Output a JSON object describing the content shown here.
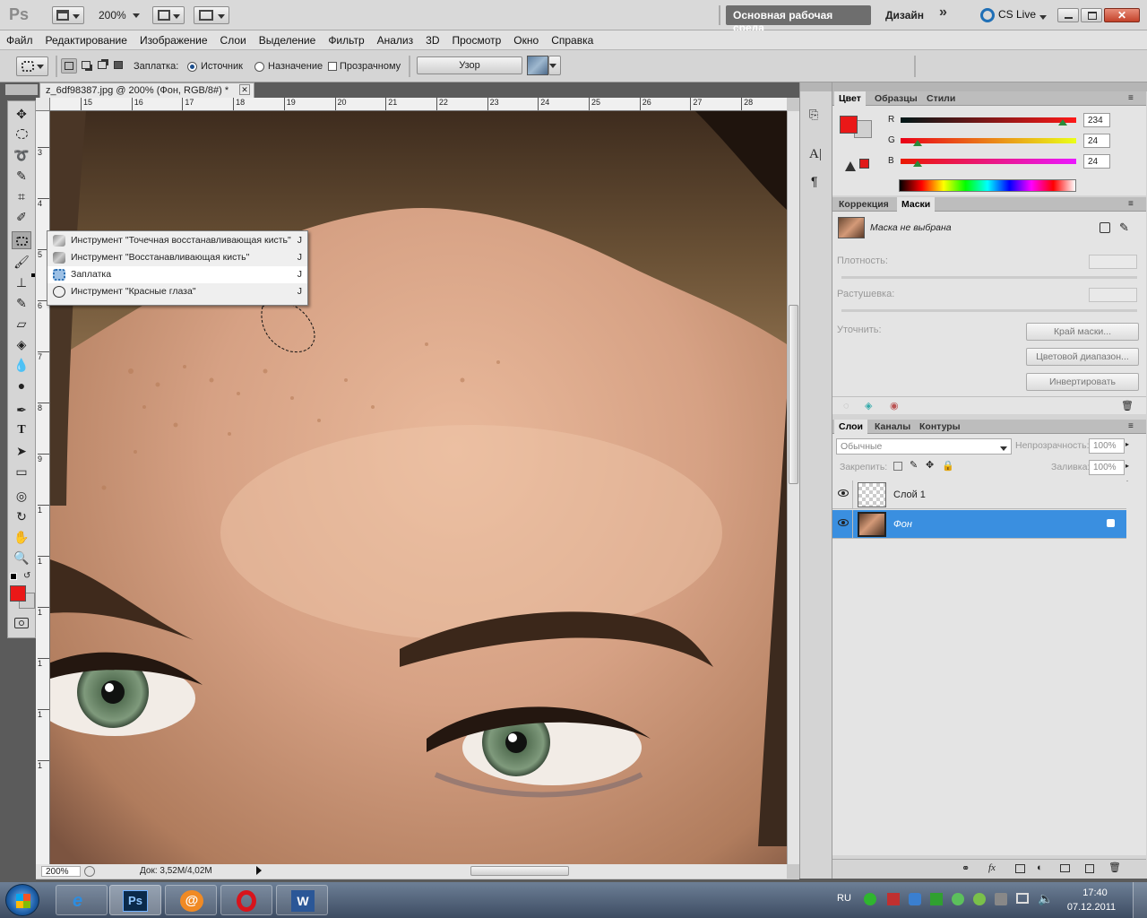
{
  "app": {
    "logo": "Ps",
    "zoom": "200%",
    "workspace": "Основная рабочая среда",
    "design": "Дизайн",
    "more": "»",
    "cslive": "CS Live"
  },
  "menu": [
    "Файл",
    "Редактирование",
    "Изображение",
    "Слои",
    "Выделение",
    "Фильтр",
    "Анализ",
    "3D",
    "Просмотр",
    "Окно",
    "Справка"
  ],
  "options": {
    "patch_label": "Заплатка:",
    "source": "Источник",
    "destination": "Назначение",
    "transparent": "Прозрачному",
    "pattern_button": "Узор"
  },
  "document": {
    "tab_title": "z_6df98387.jpg @ 200% (Фон, RGB/8#) *",
    "ruler_top": [
      "15",
      "16",
      "17",
      "18",
      "19",
      "20",
      "21",
      "22",
      "23",
      "24",
      "25",
      "26",
      "27",
      "28"
    ],
    "ruler_left": [
      "3",
      "4",
      "5",
      "6",
      "7",
      "8",
      "9",
      "1",
      "1",
      "1",
      "1",
      "1",
      "1"
    ],
    "status_zoom": "200%",
    "status_doc": "Док: 3,52M/4,02M"
  },
  "flyout": {
    "items": [
      {
        "label": "Инструмент \"Точечная восстанавливающая кисть\"",
        "key": "J"
      },
      {
        "label": "Инструмент \"Восстанавливающая кисть\"",
        "key": "J"
      },
      {
        "label": "Заплатка",
        "key": "J"
      },
      {
        "label": "Инструмент \"Красные глаза\"",
        "key": "J"
      }
    ],
    "selected_index": 2
  },
  "color_panel": {
    "tabs": [
      "Цвет",
      "Образцы",
      "Стили"
    ],
    "r_label": "R",
    "g_label": "G",
    "b_label": "B",
    "r": "234",
    "g": "24",
    "b": "24",
    "foreground": "#ea1818"
  },
  "masks_panel": {
    "tabs": [
      "Коррекция",
      "Маски"
    ],
    "mask_status": "Маска не выбрана",
    "density_label": "Плотность:",
    "feather_label": "Растушевка:",
    "refine_label": "Уточнить:",
    "btn_edge": "Край маски...",
    "btn_range": "Цветовой диапазон...",
    "btn_invert": "Инвертировать"
  },
  "layers_panel": {
    "tabs": [
      "Слои",
      "Каналы",
      "Контуры"
    ],
    "blend_mode": "Обычные",
    "opacity_label": "Непрозрачность:",
    "opacity": "100%",
    "lock_label": "Закрепить:",
    "fill_label": "Заливка:",
    "fill": "100%",
    "layers": [
      {
        "name": "Слой 1",
        "selected": false
      },
      {
        "name": "Фон",
        "selected": true
      }
    ],
    "fx": "fx"
  },
  "taskbar": {
    "lang": "RU",
    "time": "17:40",
    "date": "07.12.2011",
    "ps_label": "Ps"
  }
}
